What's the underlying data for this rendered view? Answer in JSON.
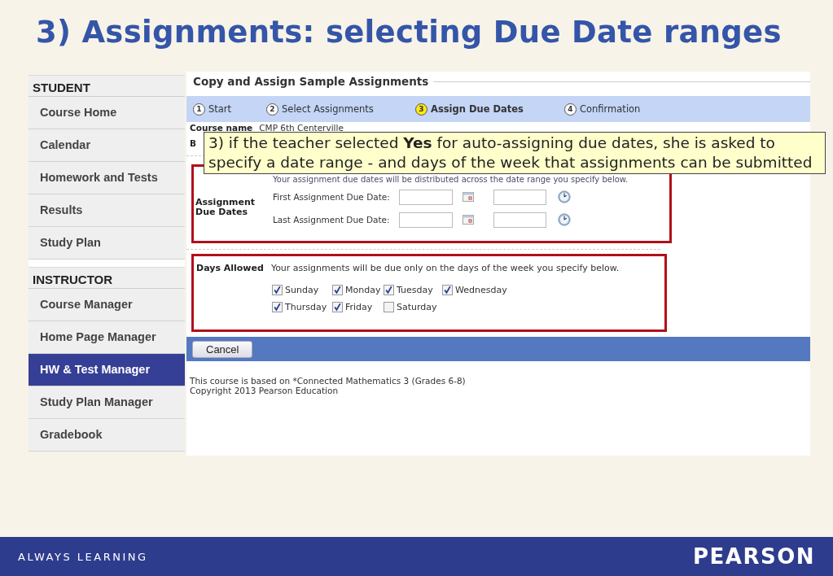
{
  "slide": {
    "title": "3) Assignments: selecting Due Date ranges"
  },
  "sidebar": {
    "sections": [
      {
        "heading": "STUDENT",
        "items": [
          {
            "label": "Course Home",
            "selected": false
          },
          {
            "label": "Calendar",
            "selected": false
          },
          {
            "label": "Homework and Tests",
            "selected": false
          },
          {
            "label": "Results",
            "selected": false
          },
          {
            "label": "Study Plan",
            "selected": false
          }
        ]
      },
      {
        "heading": "INSTRUCTOR",
        "items": [
          {
            "label": "Course Manager",
            "selected": false
          },
          {
            "label": "Home Page Manager",
            "selected": false
          },
          {
            "label": "HW & Test Manager",
            "selected": true
          },
          {
            "label": "Study Plan Manager",
            "selected": false
          },
          {
            "label": "Gradebook",
            "selected": false
          }
        ]
      }
    ]
  },
  "app": {
    "title": "Copy and Assign Sample Assignments",
    "steps": [
      {
        "number": "1",
        "label": "Start",
        "selected": false
      },
      {
        "number": "2",
        "label": "Select Assignments",
        "selected": false
      },
      {
        "number": "3",
        "label": "Assign Due Dates",
        "selected": true
      },
      {
        "number": "4",
        "label": "Confirmation",
        "selected": false
      }
    ],
    "course_name_label": "Course name",
    "course_name": "CMP 6th Centerville",
    "row_2_label": "B",
    "due_dates": {
      "label": "Assignment Due Dates",
      "hint": "Your assignment due dates will be distributed across the date range you specify below.",
      "rows": [
        {
          "label": "First Assignment Due Date:"
        },
        {
          "label": "Last Assignment Due Date:"
        }
      ]
    },
    "days": {
      "label": "Days Allowed",
      "hint": "Your assignments will be due only on the days of the week you specify below.",
      "items": [
        {
          "label": "Sunday",
          "checked": true
        },
        {
          "label": "Monday",
          "checked": true
        },
        {
          "label": "Tuesday",
          "checked": true
        },
        {
          "label": "Wednesday",
          "checked": true
        },
        {
          "label": "Thursday",
          "checked": true
        },
        {
          "label": "Friday",
          "checked": true
        },
        {
          "label": "Saturday",
          "checked": false
        }
      ]
    },
    "buttons": [
      "Cancel"
    ],
    "footer_lines": [
      "This course is based on *Connected Mathematics 3 (Grades 6-8)",
      "Copyright 2013 Pearson Education"
    ]
  },
  "callout": {
    "text": "3) if the teacher selected **Yes** for auto-assigning due dates, she is asked to specify a date range - and days of the week that assignments can be submitted"
  },
  "footer": {
    "tagline": "ALWAYS LEARNING",
    "brand": "PEARSON"
  }
}
